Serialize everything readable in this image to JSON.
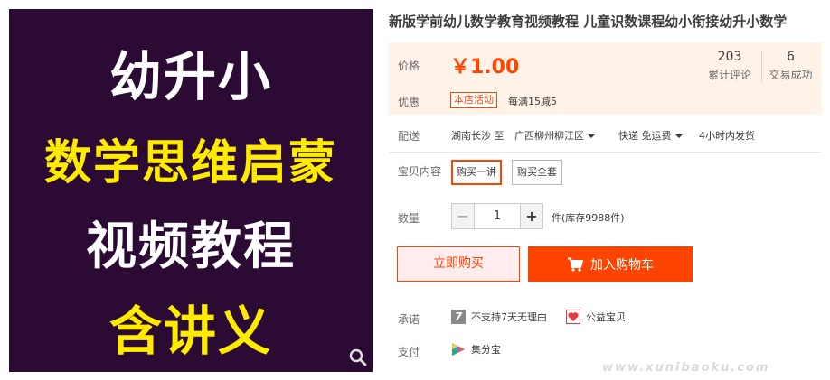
{
  "gallery": {
    "line1": "幼升小",
    "line2": "数学思维启蒙",
    "line3": "视频教程",
    "line4": "含讲义",
    "zoom_icon": "search-icon"
  },
  "title": "新版学前幼儿数学教育视频教程 儿童识数课程幼小衔接幼升小数学",
  "price": {
    "label": "价格",
    "value": "￥1.00",
    "reviews_count": "203",
    "reviews_label": "累计评论",
    "deals_count": "6",
    "deals_label": "交易成功"
  },
  "promo": {
    "label": "优惠",
    "tag": "本店活动",
    "text": "每满15减5"
  },
  "shipping": {
    "label": "配送",
    "from": "湖南长沙 至",
    "to": "广西柳州柳江区",
    "method": "快递 免运费",
    "time": "4小时内发货"
  },
  "sku": {
    "label": "宝贝内容",
    "options": [
      "购买一讲",
      "购买全套"
    ],
    "selected_index": 0
  },
  "quantity": {
    "label": "数量",
    "value": "1",
    "minus": "−",
    "plus": "+",
    "stock": "件(库存9988件)"
  },
  "actions": {
    "buy_now": "立即购买",
    "add_to_cart": "加入购物车",
    "cart_icon": "cart-icon"
  },
  "promise": {
    "label": "承诺",
    "item1": "不支持7天无理由",
    "item1_glyph": "7",
    "item2": "公益宝贝"
  },
  "payment": {
    "label": "支付",
    "method": "集分宝"
  },
  "watermark": "www.xunibaoku.com",
  "colors": {
    "accent": "#ff4400",
    "price_bg": "#fff2e8",
    "image_bg": "#2b0a33",
    "image_highlight": "#ffeb00"
  }
}
